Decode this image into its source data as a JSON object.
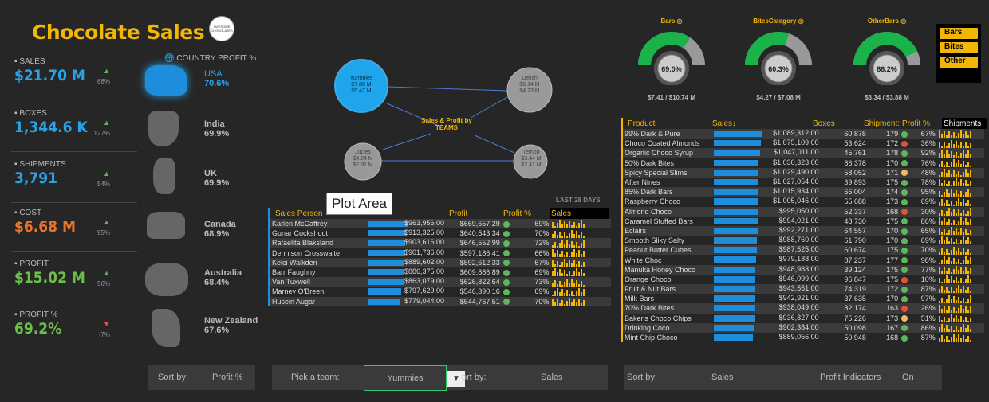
{
  "title": "Chocolate Sales",
  "logo_text": "AWESOME CHOCOLATES",
  "kpis": [
    {
      "label": "SALES",
      "value": "$21.70 M",
      "change": "68%",
      "color": "#29a3e8",
      "up": true
    },
    {
      "label": "BOXES",
      "value": "1,344.6 K",
      "change": "127%",
      "color": "#29a3e8",
      "up": true
    },
    {
      "label": "SHIPMENTS",
      "value": "3,791",
      "change": "54%",
      "color": "#29a3e8",
      "up": true
    },
    {
      "label": "COST",
      "value": "$6.68 M",
      "change": "95%",
      "color": "#e8732a",
      "up": true
    },
    {
      "label": "PROFIT",
      "value": "$15.02 M",
      "change": "56%",
      "color": "#6cc04a",
      "up": true
    },
    {
      "label": "PROFIT %",
      "value": "69.2%",
      "change": "-7%",
      "color": "#6cc04a",
      "up": false
    }
  ],
  "country_profit": {
    "heading": "COUNTRY PROFIT %",
    "items": [
      {
        "name": "USA",
        "value": "70.6%"
      },
      {
        "name": "India",
        "value": "69.9%"
      },
      {
        "name": "UK",
        "value": "69.9%"
      },
      {
        "name": "Canada",
        "value": "68.9%"
      },
      {
        "name": "Australia",
        "value": "68.4%"
      },
      {
        "name": "New Zealand",
        "value": "67.6%"
      }
    ]
  },
  "teams": {
    "center_label": "Sales & Profit by TEAMS",
    "bubbles": [
      {
        "name": "Yummies",
        "sales": "$7.80 M",
        "profit": "$5.47 M"
      },
      {
        "name": "Delish",
        "sales": "$6.14 M",
        "profit": "$4.23 M"
      },
      {
        "name": "Jucies",
        "sales": "$4.24 M",
        "profit": "$2.91 M"
      },
      {
        "name": "Tempo",
        "sales": "$3.44 M",
        "profit": "$2.41 M"
      }
    ]
  },
  "gauges": [
    {
      "label": "Bars",
      "pct": "69.0%",
      "fraction": 0.69,
      "sub": "$7.41 / $10.74 M"
    },
    {
      "label": "BitesCategory",
      "pct": "60.3%",
      "fraction": 0.603,
      "sub": "$4.27 / $7.08 M"
    },
    {
      "label": "OtherBars",
      "pct": "86.2%",
      "fraction": 0.862,
      "sub": "$3.34 / $3.88 M"
    }
  ],
  "legend": [
    "Bars",
    "Bites",
    "Other"
  ],
  "tooltip": "Plot Area",
  "last_days": "LAST 28 DAYS",
  "sales_person_table": {
    "headers": [
      "Sales Person",
      "Profit",
      "Profit %",
      "Sales"
    ],
    "rows": [
      {
        "name": "Karlen McCaffrey",
        "sales": "$963,956.00",
        "profit": "$669,657.29",
        "pct": "69%",
        "bar": 1.0,
        "dot": "#5cb85c"
      },
      {
        "name": "Gunar Cockshoot",
        "sales": "$913,325.00",
        "profit": "$640,543.34",
        "pct": "70%",
        "bar": 0.95,
        "dot": "#5cb85c"
      },
      {
        "name": "Rafaelita Blaksland",
        "sales": "$903,616.00",
        "profit": "$646,552.99",
        "pct": "72%",
        "bar": 0.94,
        "dot": "#5cb85c"
      },
      {
        "name": "Dennison Crosswaite",
        "sales": "$901,736.00",
        "profit": "$597,186.41",
        "pct": "66%",
        "bar": 0.94,
        "dot": "#5cb85c"
      },
      {
        "name": "Kelci Walkden",
        "sales": "$889,602.00",
        "profit": "$592,612.33",
        "pct": "67%",
        "bar": 0.92,
        "dot": "#5cb85c"
      },
      {
        "name": "Barr Faughny",
        "sales": "$886,375.00",
        "profit": "$609,886.89",
        "pct": "69%",
        "bar": 0.92,
        "dot": "#5cb85c"
      },
      {
        "name": "Van Tuxwell",
        "sales": "$863,079.00",
        "profit": "$626,822.64",
        "pct": "73%",
        "bar": 0.9,
        "dot": "#5cb85c"
      },
      {
        "name": "Marney O'Breen",
        "sales": "$797,629.00",
        "profit": "$546,390.16",
        "pct": "69%",
        "bar": 0.83,
        "dot": "#5cb85c"
      },
      {
        "name": "Husein Augar",
        "sales": "$779,044.00",
        "profit": "$544,767.51",
        "pct": "70%",
        "bar": 0.81,
        "dot": "#5cb85c"
      }
    ]
  },
  "product_table": {
    "headers": [
      "Product",
      "Sales↓",
      "Boxes",
      "Shipment:",
      "Profit %",
      "Shipments"
    ],
    "rows": [
      {
        "name": "99% Dark & Pure",
        "sales": "$1,089,312.00",
        "boxes": "60,878",
        "ship": "179",
        "pct": "67%",
        "bar": 1.0,
        "dot": "#5cb85c"
      },
      {
        "name": "Choco Coated Almonds",
        "sales": "$1,075,109.00",
        "boxes": "53,624",
        "ship": "172",
        "pct": "36%",
        "bar": 0.98,
        "dot": "#e0533a"
      },
      {
        "name": "Organic Choco Syrup",
        "sales": "$1,047,011.00",
        "boxes": "45,761",
        "ship": "178",
        "pct": "92%",
        "bar": 0.96,
        "dot": "#5cb85c"
      },
      {
        "name": "50% Dark Bites",
        "sales": "$1,030,323.00",
        "boxes": "86,378",
        "ship": "170",
        "pct": "76%",
        "bar": 0.94,
        "dot": "#5cb85c"
      },
      {
        "name": "Spicy Special Slims",
        "sales": "$1,029,490.00",
        "boxes": "58,052",
        "ship": "171",
        "pct": "48%",
        "bar": 0.94,
        "dot": "#f0b86a"
      },
      {
        "name": "After Nines",
        "sales": "$1,027,054.00",
        "boxes": "39,893",
        "ship": "175",
        "pct": "78%",
        "bar": 0.94,
        "dot": "#5cb85c"
      },
      {
        "name": "85% Dark Bars",
        "sales": "$1,015,934.00",
        "boxes": "66,004",
        "ship": "174",
        "pct": "95%",
        "bar": 0.93,
        "dot": "#5cb85c"
      },
      {
        "name": "Raspberry Choco",
        "sales": "$1,005,046.00",
        "boxes": "55,688",
        "ship": "173",
        "pct": "69%",
        "bar": 0.92,
        "dot": "#5cb85c"
      },
      {
        "name": "Almond Choco",
        "sales": "$995,050.00",
        "boxes": "52,337",
        "ship": "168",
        "pct": "30%",
        "bar": 0.91,
        "dot": "#e0533a"
      },
      {
        "name": "Caramel Stuffed Bars",
        "sales": "$994,021.00",
        "boxes": "48,730",
        "ship": "175",
        "pct": "86%",
        "bar": 0.91,
        "dot": "#5cb85c"
      },
      {
        "name": "Eclairs",
        "sales": "$992,271.00",
        "boxes": "64,557",
        "ship": "170",
        "pct": "65%",
        "bar": 0.91,
        "dot": "#5cb85c"
      },
      {
        "name": "Smooth Sliky Salty",
        "sales": "$988,760.00",
        "boxes": "61,790",
        "ship": "170",
        "pct": "69%",
        "bar": 0.9,
        "dot": "#5cb85c"
      },
      {
        "name": "Peanut Butter Cubes",
        "sales": "$987,525.00",
        "boxes": "60,674",
        "ship": "175",
        "pct": "70%",
        "bar": 0.9,
        "dot": "#5cb85c"
      },
      {
        "name": "White Choc",
        "sales": "$979,188.00",
        "boxes": "87,237",
        "ship": "177",
        "pct": "98%",
        "bar": 0.89,
        "dot": "#5cb85c"
      },
      {
        "name": "Manuka Honey Choco",
        "sales": "$948,983.00",
        "boxes": "39,124",
        "ship": "175",
        "pct": "77%",
        "bar": 0.87,
        "dot": "#5cb85c"
      },
      {
        "name": "Orange Choco",
        "sales": "$946,099.00",
        "boxes": "96,847",
        "ship": "175",
        "pct": "10%",
        "bar": 0.87,
        "dot": "#e0533a"
      },
      {
        "name": "Fruit & Nut Bars",
        "sales": "$943,551.00",
        "boxes": "74,319",
        "ship": "172",
        "pct": "87%",
        "bar": 0.86,
        "dot": "#5cb85c"
      },
      {
        "name": "Milk Bars",
        "sales": "$942,921.00",
        "boxes": "37,635",
        "ship": "170",
        "pct": "97%",
        "bar": 0.86,
        "dot": "#5cb85c"
      },
      {
        "name": "70% Dark Bites",
        "sales": "$938,049.00",
        "boxes": "82,174",
        "ship": "163",
        "bar": 0.86,
        "pct": "26%",
        "dot": "#e0533a"
      },
      {
        "name": "Baker's Choco Chips",
        "sales": "$936,827.00",
        "boxes": "75,226",
        "ship": "173",
        "pct": "51%",
        "bar": 0.86,
        "dot": "#f0b86a"
      },
      {
        "name": "Drinking Coco",
        "sales": "$902,384.00",
        "boxes": "50,098",
        "ship": "167",
        "pct": "86%",
        "bar": 0.83,
        "dot": "#5cb85c"
      },
      {
        "name": "Mint Chip Choco",
        "sales": "$889,056.00",
        "boxes": "50,948",
        "ship": "168",
        "pct": "87%",
        "bar": 0.82,
        "dot": "#5cb85c"
      }
    ]
  },
  "controls": {
    "sort_country_label": "Sort by:",
    "sort_country_value": "Profit %",
    "team_label": "Pick a team:",
    "team_value": "Yummies",
    "sort_people_label": "ort by:",
    "sort_people_value": "Sales",
    "sort_products_label": "Sort by:",
    "sort_products_value": "Sales",
    "profit_ind_label": "Profit Indicators",
    "profit_ind_value": "On"
  }
}
